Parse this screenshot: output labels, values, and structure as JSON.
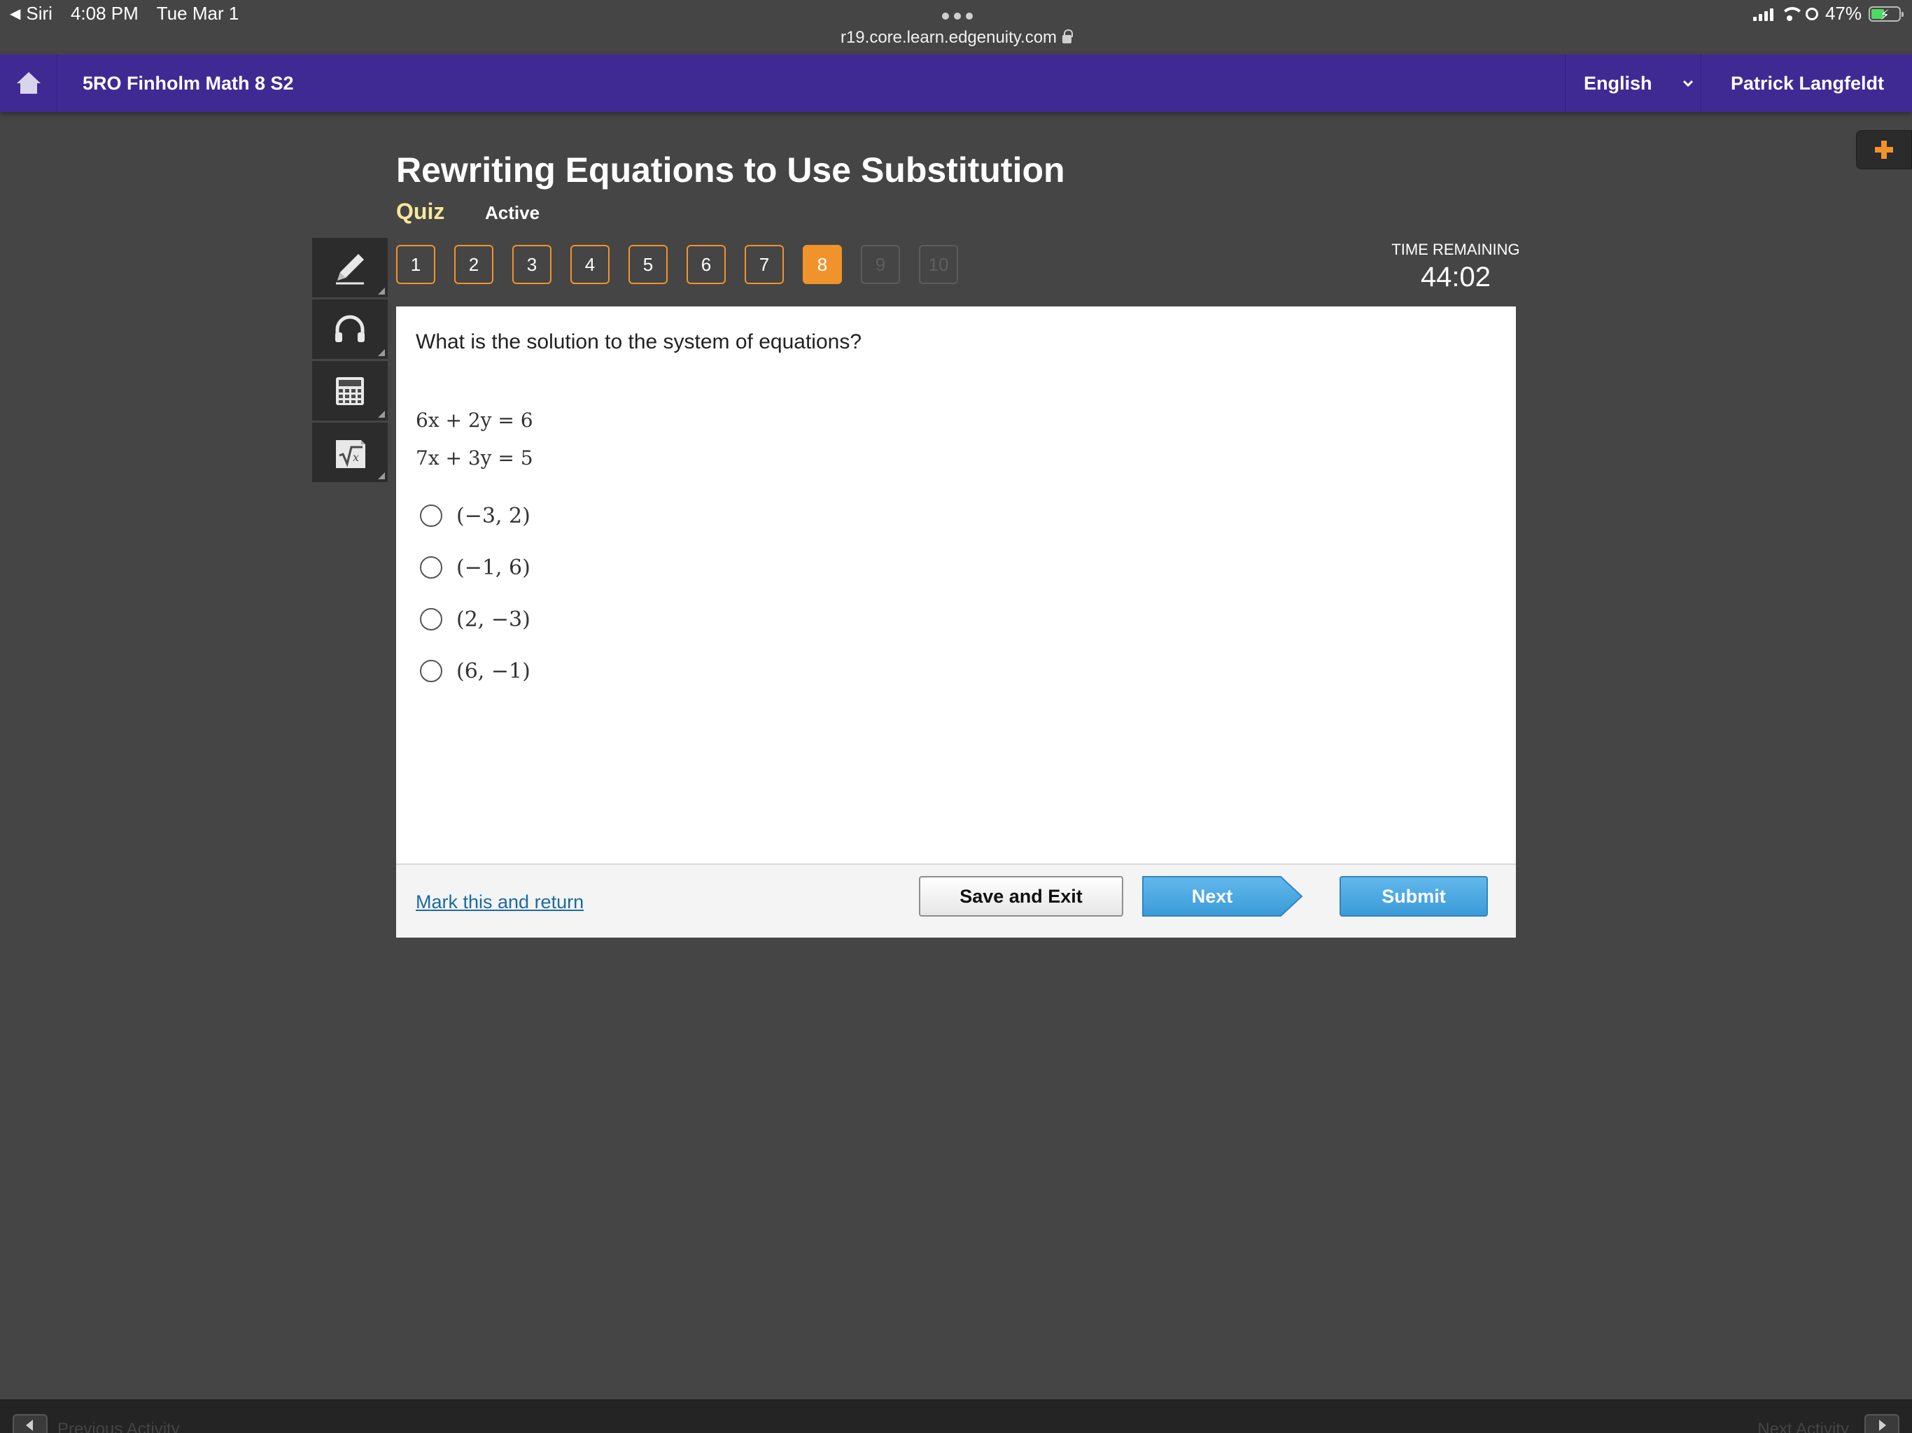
{
  "status_bar": {
    "back_app": "Siri",
    "time": "4:08 PM",
    "date": "Tue Mar 1",
    "url": "r19.core.learn.edgenuity.com",
    "battery_percent": "47%",
    "battery_level": 0.47
  },
  "header": {
    "course_title": "5RO Finholm Math 8 S2",
    "language": "English",
    "user_name": "Patrick Langfeldt",
    "brand_color": "#3f2a94"
  },
  "lesson": {
    "title": "Rewriting Equations to Use Substitution",
    "activity_type": "Quiz",
    "status": "Active"
  },
  "tools": [
    {
      "name": "pencil-icon"
    },
    {
      "name": "headphones-icon"
    },
    {
      "name": "calculator-icon"
    },
    {
      "name": "formula-icon"
    }
  ],
  "question_nav": {
    "items": [
      "1",
      "2",
      "3",
      "4",
      "5",
      "6",
      "7",
      "8",
      "9",
      "10"
    ],
    "current": "8",
    "accent_color": "#f0932a"
  },
  "timer": {
    "label": "TIME REMAINING",
    "value": "44:02"
  },
  "question": {
    "prompt": "What is the solution to the system of equations?",
    "equations": [
      "6x + 2y = 6",
      "7x + 3y = 5"
    ],
    "choices": [
      "(−3, 2)",
      "(−1, 6)",
      "(2, −3)",
      "(6, −1)"
    ]
  },
  "footer": {
    "mark_link": "Mark this and return",
    "save_label": "Save and Exit",
    "next_label": "Next",
    "submit_label": "Submit"
  },
  "bottom_bar": {
    "prev_label": "Previous Activity",
    "next_label": "Next Activity"
  }
}
